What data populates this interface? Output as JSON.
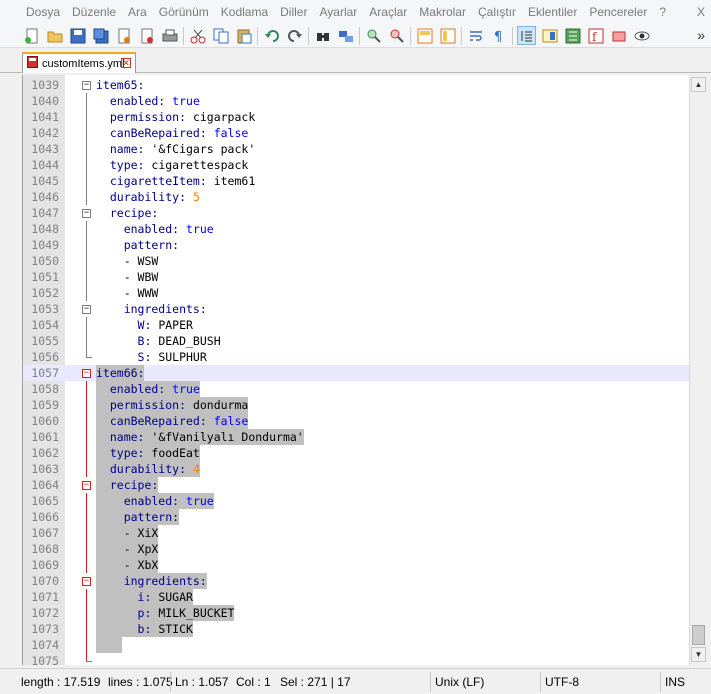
{
  "menu": {
    "items": [
      "Dosya",
      "Düzenle",
      "Ara",
      "Görünüm",
      "Kodlama",
      "Diller",
      "Ayarlar",
      "Araçlar",
      "Makrolar",
      "Çalıştır",
      "Eklentiler",
      "Pencereler",
      "?"
    ],
    "close": "X"
  },
  "toolbar": {
    "icons": [
      "new-file-icon",
      "open-file-icon",
      "save-icon",
      "save-all-icon",
      "close-icon",
      "close-all-icon",
      "print-icon",
      "cut-icon",
      "copy-icon",
      "paste-icon",
      "undo-icon",
      "redo-icon",
      "find-icon",
      "replace-icon",
      "zoom-in-icon",
      "zoom-out-icon",
      "sync-vertical-icon",
      "sync-horizontal-icon",
      "word-wrap-icon",
      "show-all-chars-icon",
      "indent-guide-icon",
      "document-map-icon",
      "function-list-icon",
      "folder-workspace-icon",
      "monitoring-icon",
      "macro-record-icon"
    ],
    "more": "»"
  },
  "tab": {
    "label": "customItems.yml"
  },
  "editor": {
    "lines": [
      {
        "num": "1039",
        "fold": "minus",
        "code": [
          {
            "c": "k",
            "t": "item65:"
          }
        ]
      },
      {
        "num": "1040",
        "code": [
          {
            "c": "k",
            "t": "  enabled: "
          },
          {
            "c": "b",
            "t": "true"
          }
        ]
      },
      {
        "num": "1041",
        "code": [
          {
            "c": "k",
            "t": "  permission: "
          },
          {
            "c": "t",
            "t": "cigarpack"
          }
        ]
      },
      {
        "num": "1042",
        "code": [
          {
            "c": "k",
            "t": "  canBeRepaired: "
          },
          {
            "c": "b",
            "t": "false"
          }
        ]
      },
      {
        "num": "1043",
        "code": [
          {
            "c": "k",
            "t": "  name: "
          },
          {
            "c": "t",
            "t": "'&fCigars pack'"
          }
        ]
      },
      {
        "num": "1044",
        "code": [
          {
            "c": "k",
            "t": "  type: "
          },
          {
            "c": "t",
            "t": "cigarettespack"
          }
        ]
      },
      {
        "num": "1045",
        "code": [
          {
            "c": "k",
            "t": "  cigaretteItem: "
          },
          {
            "c": "t",
            "t": "item61"
          }
        ]
      },
      {
        "num": "1046",
        "code": [
          {
            "c": "k",
            "t": "  durability: "
          },
          {
            "c": "n",
            "t": "5"
          }
        ]
      },
      {
        "num": "1047",
        "fold": "minus",
        "code": [
          {
            "c": "k",
            "t": "  recipe:"
          }
        ]
      },
      {
        "num": "1048",
        "code": [
          {
            "c": "k",
            "t": "    enabled: "
          },
          {
            "c": "b",
            "t": "true"
          }
        ]
      },
      {
        "num": "1049",
        "code": [
          {
            "c": "k",
            "t": "    pattern:"
          }
        ]
      },
      {
        "num": "1050",
        "code": [
          {
            "c": "t",
            "t": "    - WSW"
          }
        ]
      },
      {
        "num": "1051",
        "code": [
          {
            "c": "t",
            "t": "    - WBW"
          }
        ]
      },
      {
        "num": "1052",
        "code": [
          {
            "c": "t",
            "t": "    - WWW"
          }
        ]
      },
      {
        "num": "1053",
        "fold": "minus",
        "code": [
          {
            "c": "k",
            "t": "    ingredients:"
          }
        ]
      },
      {
        "num": "1054",
        "code": [
          {
            "c": "k",
            "t": "      W: "
          },
          {
            "c": "t",
            "t": "PAPER"
          }
        ]
      },
      {
        "num": "1055",
        "code": [
          {
            "c": "k",
            "t": "      B: "
          },
          {
            "c": "t",
            "t": "DEAD_BUSH"
          }
        ]
      },
      {
        "num": "1056",
        "corner": true,
        "code": [
          {
            "c": "k",
            "t": "      S: "
          },
          {
            "c": "t",
            "t": "SULPHUR"
          }
        ]
      },
      {
        "num": "1057",
        "fold": "minus-sel",
        "current": true,
        "sel": true,
        "code": [
          {
            "c": "k",
            "t": "item66:"
          }
        ]
      },
      {
        "num": "1058",
        "sel": true,
        "code": [
          {
            "c": "k",
            "t": "  enabled: "
          },
          {
            "c": "b",
            "t": "true"
          }
        ]
      },
      {
        "num": "1059",
        "sel": true,
        "code": [
          {
            "c": "k",
            "t": "  permission: "
          },
          {
            "c": "t",
            "t": "dondurma"
          }
        ]
      },
      {
        "num": "1060",
        "sel": true,
        "code": [
          {
            "c": "k",
            "t": "  canBeRepaired: "
          },
          {
            "c": "b",
            "t": "false"
          }
        ]
      },
      {
        "num": "1061",
        "sel": true,
        "code": [
          {
            "c": "k",
            "t": "  name: "
          },
          {
            "c": "t",
            "t": "'&fVanilyalı Dondurma'"
          }
        ]
      },
      {
        "num": "1062",
        "sel": true,
        "code": [
          {
            "c": "k",
            "t": "  type: "
          },
          {
            "c": "t",
            "t": "foodEat"
          }
        ]
      },
      {
        "num": "1063",
        "sel": true,
        "code": [
          {
            "c": "k",
            "t": "  durability: "
          },
          {
            "c": "n",
            "t": "4"
          }
        ]
      },
      {
        "num": "1064",
        "fold": "minus-sel",
        "sel": true,
        "code": [
          {
            "c": "k",
            "t": "  recipe:"
          }
        ]
      },
      {
        "num": "1065",
        "sel": true,
        "code": [
          {
            "c": "k",
            "t": "    enabled: "
          },
          {
            "c": "b",
            "t": "true"
          }
        ]
      },
      {
        "num": "1066",
        "sel": true,
        "code": [
          {
            "c": "k",
            "t": "    pattern:"
          }
        ]
      },
      {
        "num": "1067",
        "sel": true,
        "code": [
          {
            "c": "t",
            "t": "    - XiX"
          }
        ]
      },
      {
        "num": "1068",
        "sel": true,
        "code": [
          {
            "c": "t",
            "t": "    - XpX"
          }
        ]
      },
      {
        "num": "1069",
        "sel": true,
        "code": [
          {
            "c": "t",
            "t": "    - XbX"
          }
        ]
      },
      {
        "num": "1070",
        "fold": "minus-sel",
        "sel": true,
        "code": [
          {
            "c": "k",
            "t": "    ingredients:"
          }
        ]
      },
      {
        "num": "1071",
        "sel": true,
        "code": [
          {
            "c": "k",
            "t": "      i: "
          },
          {
            "c": "t",
            "t": "SUGAR"
          }
        ]
      },
      {
        "num": "1072",
        "sel": true,
        "code": [
          {
            "c": "k",
            "t": "      p: "
          },
          {
            "c": "t",
            "t": "MILK_BUCKET"
          }
        ]
      },
      {
        "num": "1073",
        "sel": true,
        "code": [
          {
            "c": "k",
            "t": "      b: "
          },
          {
            "c": "t",
            "t": "STICK"
          }
        ]
      },
      {
        "num": "1074",
        "selbar": true,
        "code": []
      },
      {
        "num": "1075",
        "corner-sel": true,
        "code": []
      }
    ]
  },
  "status": {
    "length": "length : 17.519",
    "lines": "lines : 1.075",
    "ln": "Ln : 1.057",
    "col": "Col : 1",
    "sel": "Sel : 271 | 17",
    "eol": "Unix (LF)",
    "encoding": "UTF-8",
    "mode": "INS"
  },
  "colors": {
    "keyword": "#00008b",
    "boolean": "#0000ff",
    "number": "#ff8000",
    "selection": "#c0c0c0",
    "current_line": "#e8e8ff",
    "fold_selected": "#d02020",
    "tab_accent": "#f5a623"
  }
}
